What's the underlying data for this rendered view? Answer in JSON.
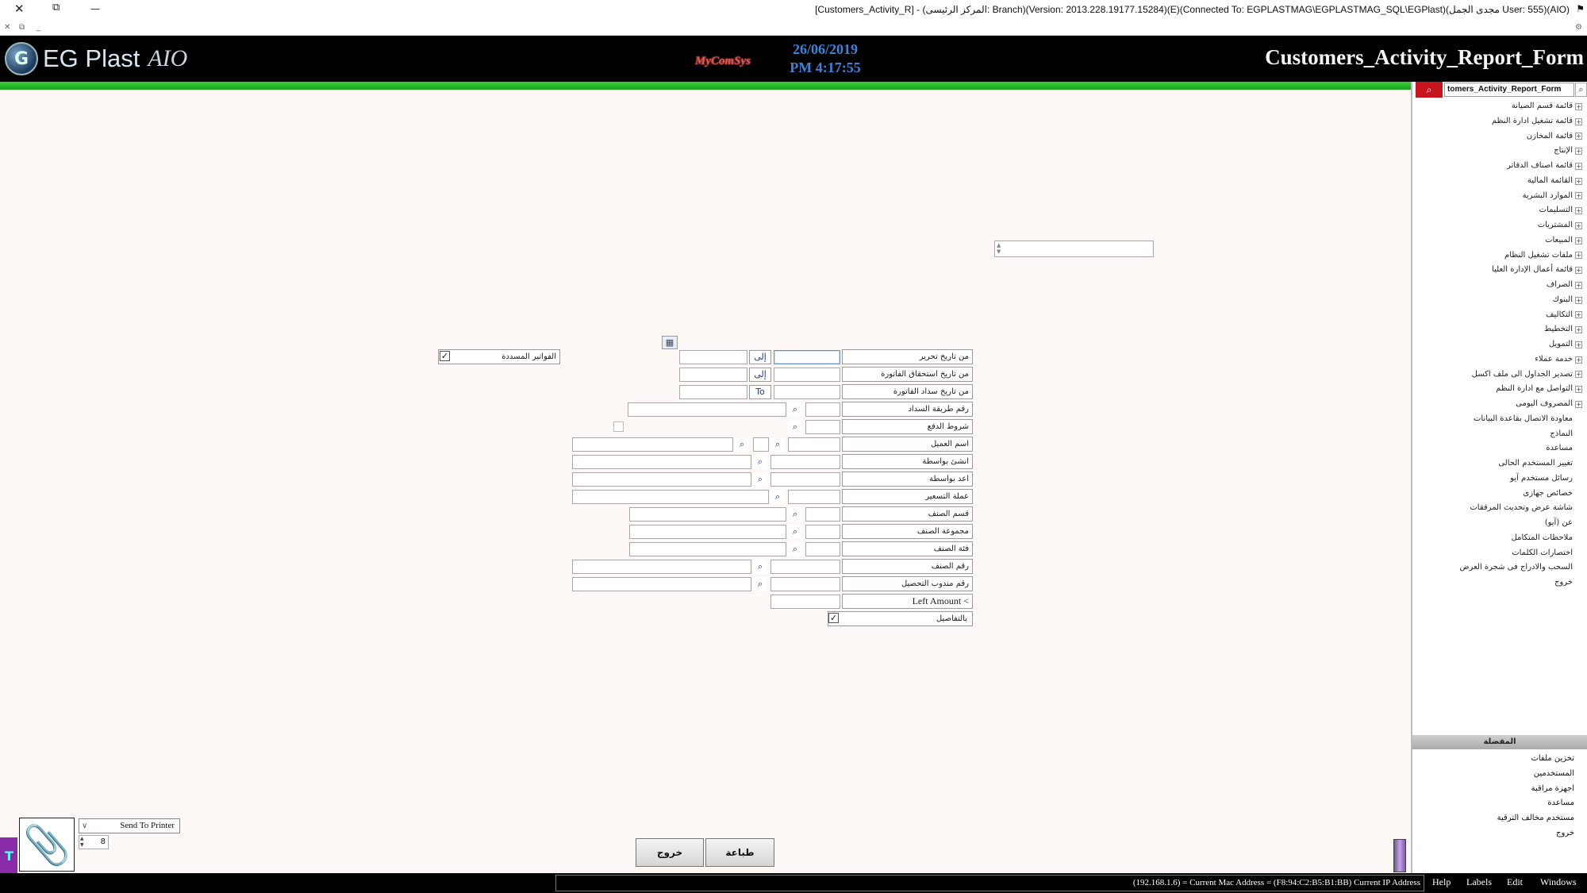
{
  "window": {
    "title": "[Customers_Activity_R] - (المركز الرئيسى: Branch)(Version: 2013.228.19177.15284)(E)(Connected To: EGPLASTMAG\\EGPLASTMAG_SQL\\EGPlast)(مجدى الجمل User: 555)(AIO)",
    "close_glyph": "✕",
    "restore_glyph": "⧉",
    "minimize_glyph": "—",
    "sub_close": "✕",
    "sub_restore": "⧉",
    "sub_min": "_"
  },
  "banner": {
    "app_name": "EG Plast",
    "app_suffix": "AIO",
    "logo_letter": "G",
    "vendor": "MyComSys",
    "date": "26/06/2019",
    "time": "PM 4:17:55",
    "form_name": "Customers_Activity_Report_Form"
  },
  "sidebar": {
    "search_value": "tomers_Activity_Report_Form",
    "menu_items": [
      "قائمة قسم الصيانة",
      "قائمة تشغيل ادارة النظم",
      "قائمة المخازن",
      "الإنتاج",
      "قائمة اصناف الدفاتر",
      "القائمة المالية",
      "الموارد البشرية",
      "التسليمات",
      "المشتريات",
      "المبيعات",
      "ملفات تشغيل النظام",
      "قائمة أعمال الإدارة العليا",
      "الصراف",
      "البنوك",
      "التكاليف",
      "التخطيط",
      "التمويل",
      "خدمة عملاء",
      "تصدير الجداول الى ملف اكسل",
      "التواصل مع ادارة النظم",
      "المصروف اليومى",
      "معاودة الاتصال بقاعدة البيانات",
      "النماذج",
      "مساعدة",
      "تغيير المستخدم الحالى",
      "رسائل مستخدم آيو",
      "خصائص جهازى",
      "شاشة عرض وتحديث المرفقات",
      "عن (آيو)",
      "ملاحظات المتكامل",
      "اختصارات الكلمات",
      "السحب والادراج فى شجرة العرض",
      "خروج"
    ],
    "favorites_title": "المفضلة",
    "favorites": [
      "تخزين ملفات",
      "المستخدمين",
      "اجهزة مراقبة",
      "مساعدة",
      "مستخدم مخالف الترقية",
      "خروج"
    ]
  },
  "form": {
    "labels": {
      "invoice_date_from": "من تاريخ تحرير",
      "due_date_from": "من تاريخ استحقاق الفاتورة",
      "payment_date_from": "من تاريخ سداد الفاتورة",
      "payment_method": "رقم طريقة السداد",
      "payment_terms": "شروط الدفع",
      "customer_name": "اسم العميل",
      "created_by": "انشئ بواسطة",
      "prepared_by": "اعد بواسطة",
      "currency": "عملة التسعير",
      "item_section": "قسم الصنف",
      "item_group": "مجموعة الصنف",
      "item_category": "فئة الصنف",
      "item_number": "رقم الصنف",
      "collector_number": "رقم مندوب التحصيل",
      "left_amount": "Left Amount <",
      "details": "بالتفاصيل",
      "paid_invoices": "الفواتير المسددة"
    },
    "to_label_ar": "إلى",
    "to_label_en": "To",
    "search_glyph": "⌕",
    "check_glyph": "✓"
  },
  "bottom": {
    "print_target": "Send To Printer",
    "copies": "8",
    "exit_button": "خروج",
    "print_button": "طباعة"
  },
  "status": {
    "text": "(192.168.1.6) = Current Mac Address = (F8:94:C2:B5:B1:BB) Current IP Address",
    "menus": [
      "Help",
      "Labels",
      "Edit",
      "Windows"
    ]
  }
}
